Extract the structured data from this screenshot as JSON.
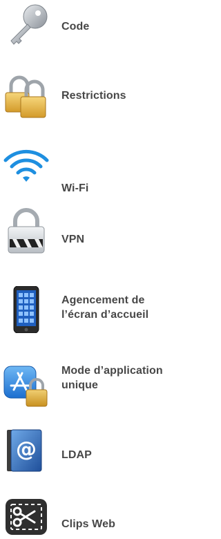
{
  "items": [
    {
      "id": "code",
      "label_line1": "Code",
      "label_line2": "",
      "icon": "key-icon"
    },
    {
      "id": "restrictions",
      "label_line1": "Restrictions",
      "label_line2": "",
      "icon": "padlocks-icon"
    },
    {
      "id": "wifi",
      "label_line1": "Wi-Fi",
      "label_line2": "",
      "icon": "wifi-icon"
    },
    {
      "id": "vpn",
      "label_line1": "VPN",
      "label_line2": "",
      "icon": "vpn-lock-icon"
    },
    {
      "id": "home-layout",
      "label_line1": "Agencement de",
      "label_line2": "l’écran d’accueil",
      "icon": "iphone-icon"
    },
    {
      "id": "single-app",
      "label_line1": "Mode d’application",
      "label_line2": "unique",
      "icon": "app-store-lock-icon"
    },
    {
      "id": "ldap",
      "label_line1": "LDAP",
      "label_line2": "",
      "icon": "address-book-icon"
    },
    {
      "id": "webclips",
      "label_line1": "Clips Web",
      "label_line2": "",
      "icon": "scissors-icon"
    }
  ]
}
